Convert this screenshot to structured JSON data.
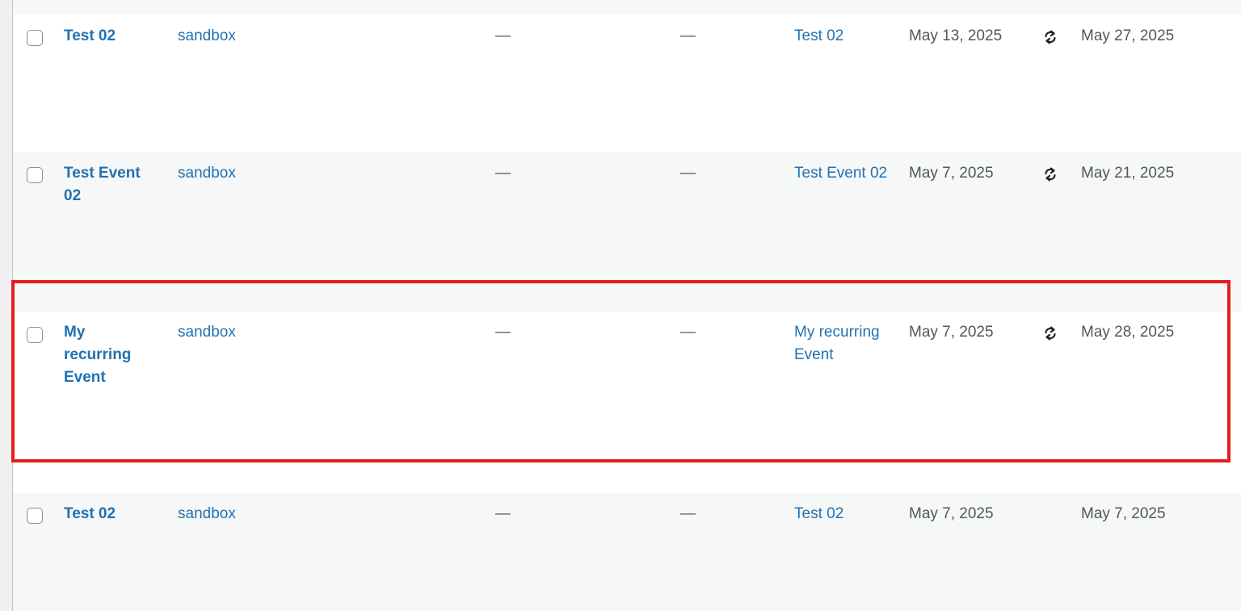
{
  "rows": [
    {
      "title": "Test 02",
      "author": "sandbox",
      "col3": "—",
      "col4": "—",
      "event": "Test 02",
      "start": "May 13, 2025",
      "recurring": true,
      "end": "May 27, 2025"
    },
    {
      "title": "Test Event 02",
      "author": "sandbox",
      "col3": "—",
      "col4": "—",
      "event": "Test Event 02",
      "start": "May 7, 2025",
      "recurring": true,
      "end": "May 21, 2025"
    },
    {
      "title": "My recurring Event",
      "author": "sandbox",
      "col3": "—",
      "col4": "—",
      "event": "My recurring Event",
      "start": "May 7, 2025",
      "recurring": true,
      "end": "May 28, 2025",
      "highlighted": true
    },
    {
      "title": "Test 02",
      "author": "sandbox",
      "col3": "—",
      "col4": "—",
      "event": "Test 02",
      "start": "May 7, 2025",
      "recurring": false,
      "end": "May 7, 2025"
    }
  ],
  "icons": {
    "recurring": "repeat-icon"
  },
  "colors": {
    "link": "#2271b1",
    "text": "#50575e",
    "highlight": "#e51c1f"
  }
}
